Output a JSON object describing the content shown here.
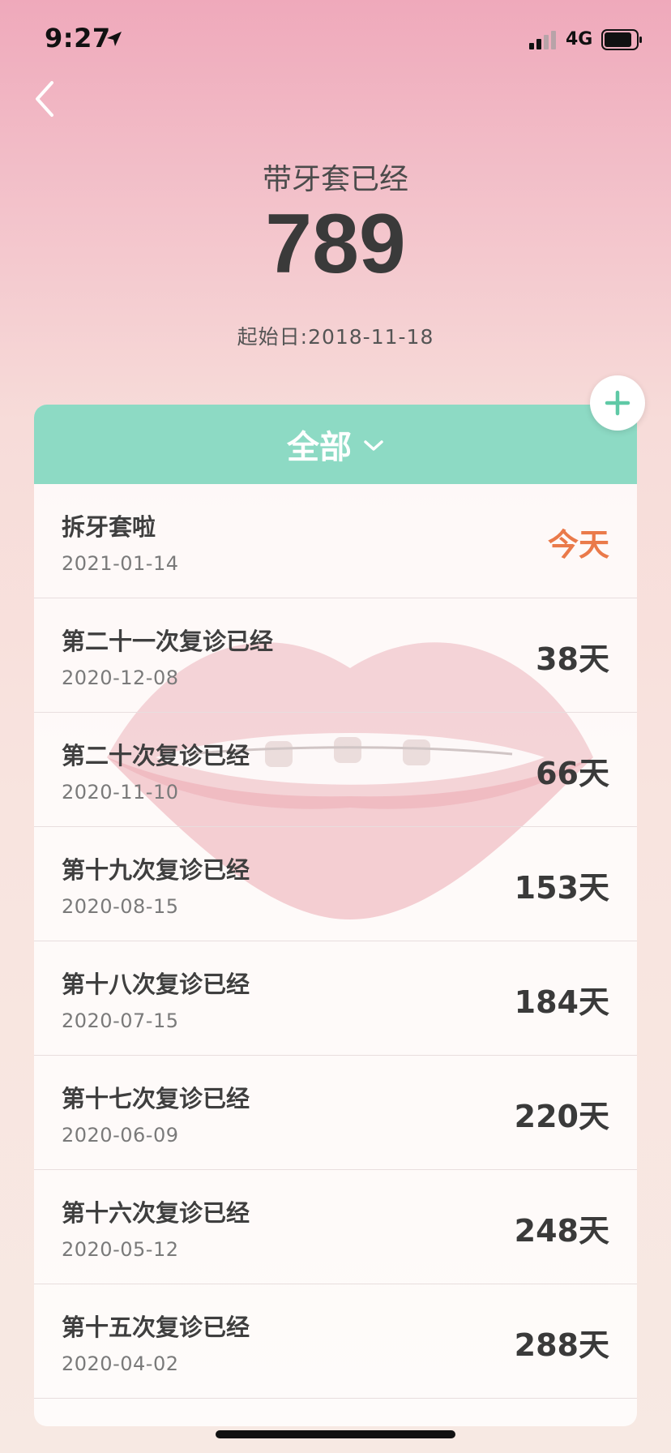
{
  "status_bar": {
    "time": "9:27",
    "network": "4G",
    "icons": [
      "location-arrow-icon",
      "signal-bars-icon",
      "battery-icon"
    ]
  },
  "header": {
    "label": "带牙套已经",
    "count": "789",
    "start_date": "起始日:2018-11-18"
  },
  "filter": {
    "label": "全部"
  },
  "records": [
    {
      "title": "拆牙套啦",
      "date": "2021-01-14",
      "days": "今天",
      "highlight": true
    },
    {
      "title": "第二十一次复诊已经",
      "date": "2020-12-08",
      "days": "38天"
    },
    {
      "title": "第二十次复诊已经",
      "date": "2020-11-10",
      "days": "66天"
    },
    {
      "title": "第十九次复诊已经",
      "date": "2020-08-15",
      "days": "153天"
    },
    {
      "title": "第十八次复诊已经",
      "date": "2020-07-15",
      "days": "184天"
    },
    {
      "title": "第十七次复诊已经",
      "date": "2020-06-09",
      "days": "220天"
    },
    {
      "title": "第十六次复诊已经",
      "date": "2020-05-12",
      "days": "248天"
    },
    {
      "title": "第十五次复诊已经",
      "date": "2020-04-02",
      "days": "288天"
    }
  ],
  "colors": {
    "accent_teal": "#8ddac4",
    "highlight_orange": "#ea7a4a",
    "text_dark": "#3a3a3a",
    "background_pink": "#efa9bb"
  }
}
